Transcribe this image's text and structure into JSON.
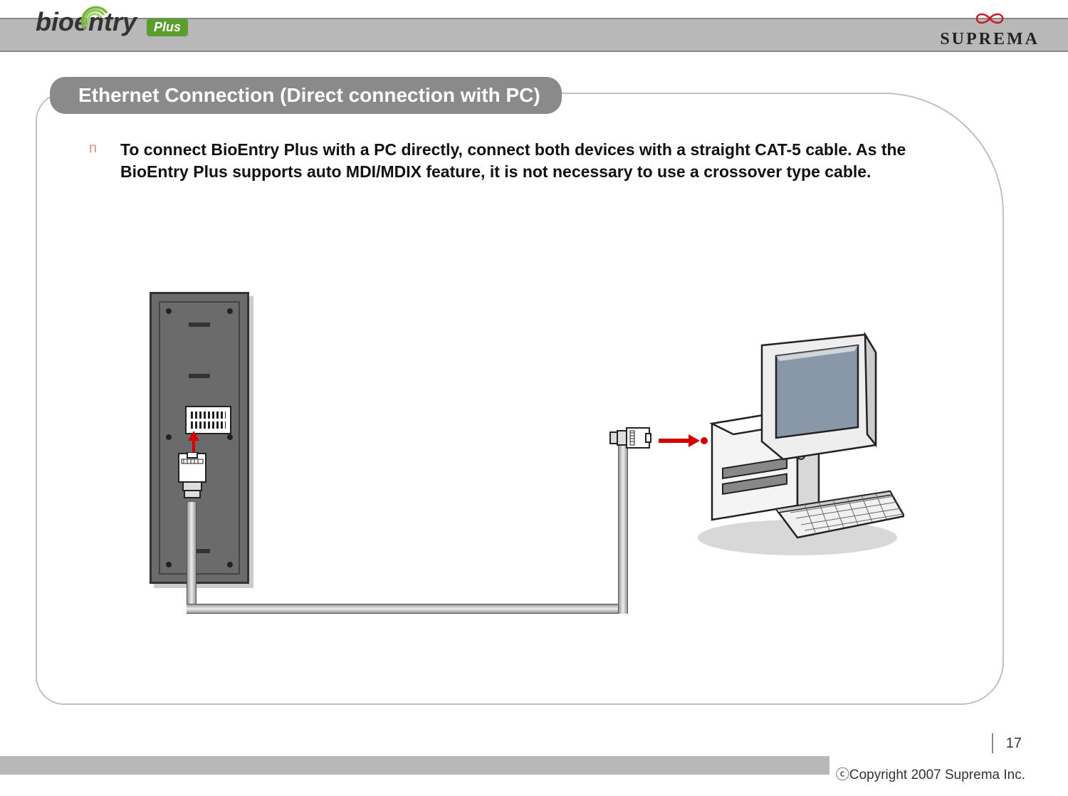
{
  "logos": {
    "bioentry_prefix": "bio",
    "bioentry_suffix": "entry",
    "plus_badge": "Plus",
    "suprema": "SUPREMA"
  },
  "title": "Ethernet Connection (Direct connection with PC)",
  "bullet": {
    "marker": "n",
    "text": "To connect BioEntry Plus with a PC directly, connect both devices with a straight CAT-5 cable. As the BioEntry Plus supports auto MDI/MDIX feature, it is not necessary to use a crossover type cable."
  },
  "footer": {
    "page_number": "17",
    "copyright": "ⓒCopyright 2007 Suprema Inc."
  }
}
